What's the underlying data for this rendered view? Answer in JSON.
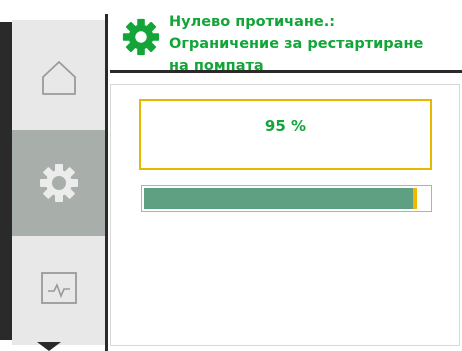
{
  "header": {
    "title_line1": "Нулево протичане.:",
    "title_line2": "Ограничение за рестартиране",
    "title_line3": "на помпата",
    "icon": "gear-icon"
  },
  "sidebar": {
    "items": [
      {
        "name": "home",
        "icon": "home-icon",
        "active": false
      },
      {
        "name": "settings",
        "icon": "gear-icon",
        "active": true
      },
      {
        "name": "diagnostics",
        "icon": "monitor-icon",
        "active": false
      }
    ]
  },
  "value": {
    "display": "95 %",
    "percent": 95
  },
  "colors": {
    "accent": "#13a538",
    "focus": "#e8b800",
    "bar": "#5fa083",
    "active_tab": "#a8aeaa"
  }
}
